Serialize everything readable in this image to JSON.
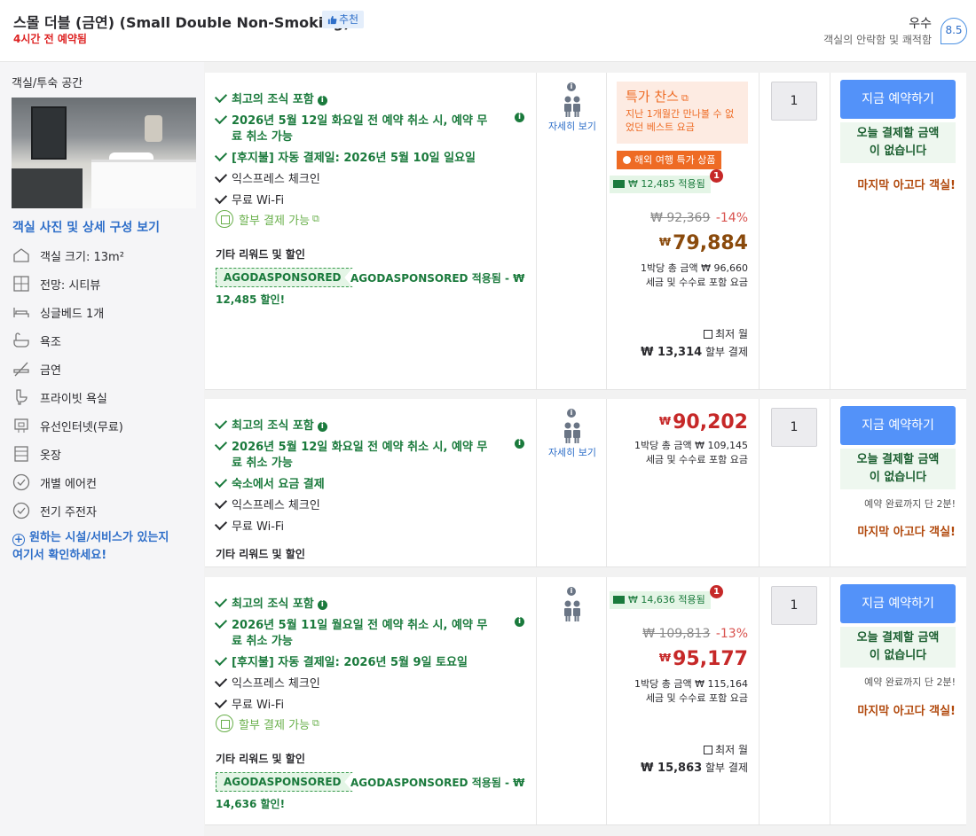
{
  "header": {
    "room_title": "스몰 더블 (금연) (Small Double Non-Smoking)",
    "recommend_label": "추천",
    "booked_notice": "4시간 전 예약됨",
    "score_label": "우수",
    "score_sub": "객실의 안락함 및 쾌적함",
    "score_value": "8.5"
  },
  "sidebar": {
    "title": "객실/투숙 공간",
    "photo_link": "객실 사진 및 상세 구성 보기",
    "amenities": [
      {
        "label": "객실 크기: 13m²",
        "icon": "house-icon"
      },
      {
        "label": "전망: 시티뷰",
        "icon": "window-icon"
      },
      {
        "label": "싱글베드 1개",
        "icon": "bed-icon"
      },
      {
        "label": "욕조",
        "icon": "bathtub-icon"
      },
      {
        "label": "금연",
        "icon": "no-smoking-icon"
      },
      {
        "label": "프라이빗 욕실",
        "icon": "toilet-icon"
      },
      {
        "label": "유선인터넷(무료)",
        "icon": "ethernet-icon"
      },
      {
        "label": "옷장",
        "icon": "wardrobe-icon"
      },
      {
        "label": "개별 에어컨",
        "icon": "check-circle-icon"
      },
      {
        "label": "전기 주전자",
        "icon": "check-circle-icon"
      }
    ],
    "facility_link_line1": "원하는 시설/서비스가 있는지",
    "facility_link_line2": "여기서 확인하세요!"
  },
  "offers": [
    {
      "features": {
        "breakfast": "최고의 조식 포함",
        "cancel_line1": "2026년 5월 12일 화요일 전 예약 취소 시, 예약 무",
        "cancel_line2": "료 취소 가능",
        "payment": "[후지불] 자동 결제일: 2026년 5월 10일 일요일",
        "checkin": "익스프레스 체크인",
        "wifi": "무료 Wi-Fi",
        "installment": "할부 결제 가능",
        "other_title": "기타 리워드 및 할인",
        "coupon_code": "AGODASPONSORED",
        "coupon_text1": "AGODASPONSORED 적용됨 - ₩",
        "coupon_text2": "12,485 할인!"
      },
      "people_link": "자세히 보기",
      "price": {
        "deal_title": "특가 찬스",
        "deal_sub": "지난 1개월간 만나볼 수 없었던 베스트 요금",
        "overseas_tag": "해외 여행 특가 상품",
        "applied": "₩ 12,485 적용됨",
        "notif_count": "1",
        "original": "₩ 92,369",
        "discount": "-14%",
        "currency": "₩",
        "final": "79,884",
        "note1": "1박당 총 금액 ₩ 96,660",
        "note2": "세금 및 수수료 포함 요금",
        "min_month": "최저 월",
        "installment_amount": "₩ 13,314",
        "installment_suffix": "할부 결제"
      },
      "qty": "1",
      "book_label": "지금 예약하기",
      "pay_line1": "오늘 결제할 금액",
      "pay_line2": "이 없습니다",
      "last_room": "마지막 아고다 객실!"
    },
    {
      "features": {
        "breakfast": "최고의 조식 포함",
        "cancel_line1": "2026년 5월 12일 화요일 전 예약 취소 시, 예약 무",
        "cancel_line2": "료 취소 가능",
        "payment": "숙소에서 요금 결제",
        "checkin": "익스프레스 체크인",
        "wifi": "무료 Wi-Fi",
        "other_title": "기타 리워드 및 할인"
      },
      "people_link": "자세히 보기",
      "price": {
        "currency": "₩",
        "final": "90,202",
        "note1": "1박당 총 금액 ₩ 109,145",
        "note2": "세금 및 수수료 포함 요금"
      },
      "qty": "1",
      "book_label": "지금 예약하기",
      "pay_line1": "오늘 결제할 금액",
      "pay_line2": "이 없습니다",
      "remain": "예약 완료까지 단 2분!",
      "last_room": "마지막 아고다 객실!"
    },
    {
      "features": {
        "breakfast": "최고의 조식 포함",
        "cancel_line1": "2026년 5월 11일 월요일 전 예약 취소 시, 예약 무",
        "cancel_line2": "료 취소 가능",
        "payment": "[후지불] 자동 결제일: 2026년 5월 9일 토요일",
        "checkin": "익스프레스 체크인",
        "wifi": "무료 Wi-Fi",
        "installment": "할부 결제 가능",
        "other_title": "기타 리워드 및 할인",
        "coupon_code": "AGODASPONSORED",
        "coupon_text1": "AGODASPONSORED 적용됨 - ₩",
        "coupon_text2": "14,636 할인!"
      },
      "price": {
        "applied": "₩ 14,636 적용됨",
        "notif_count": "1",
        "original": "₩ 109,813",
        "discount": "-13%",
        "currency": "₩",
        "final": "95,177",
        "note1": "1박당 총 금액 ₩ 115,164",
        "note2": "세금 및 수수료 포함 요금",
        "min_month": "최저 월",
        "installment_amount": "₩ 15,863",
        "installment_suffix": "할부 결제"
      },
      "qty": "1",
      "book_label": "지금 예약하기",
      "pay_line1": "오늘 결제할 금액",
      "pay_line2": "이 없습니다",
      "remain": "예약 완료까지 단 2분!",
      "last_room": "마지막 아고다 객실!"
    }
  ],
  "colors": {
    "brand_blue": "#5392f9",
    "green": "#1a7a3c",
    "price_red": "#c62828",
    "deal_orange": "#ee6b24"
  }
}
